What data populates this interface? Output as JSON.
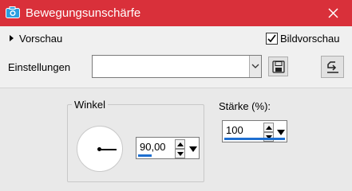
{
  "window": {
    "title": "Bewegungsunschärfe",
    "icon": "camera-icon",
    "close_icon": "close-icon",
    "accent_color": "#d9303a"
  },
  "preview": {
    "label": "Vorschau",
    "icon": "triangle-right-icon"
  },
  "image_preview": {
    "label": "Bildvorschau",
    "checked": true
  },
  "settings": {
    "label": "Einstellungen",
    "value": "",
    "save_icon": "floppy-disk-icon",
    "reset_icon": "reset-icon"
  },
  "angle": {
    "group_label": "Winkel",
    "value": "90,00"
  },
  "strength": {
    "label": "Stärke (%):",
    "value": "100"
  }
}
